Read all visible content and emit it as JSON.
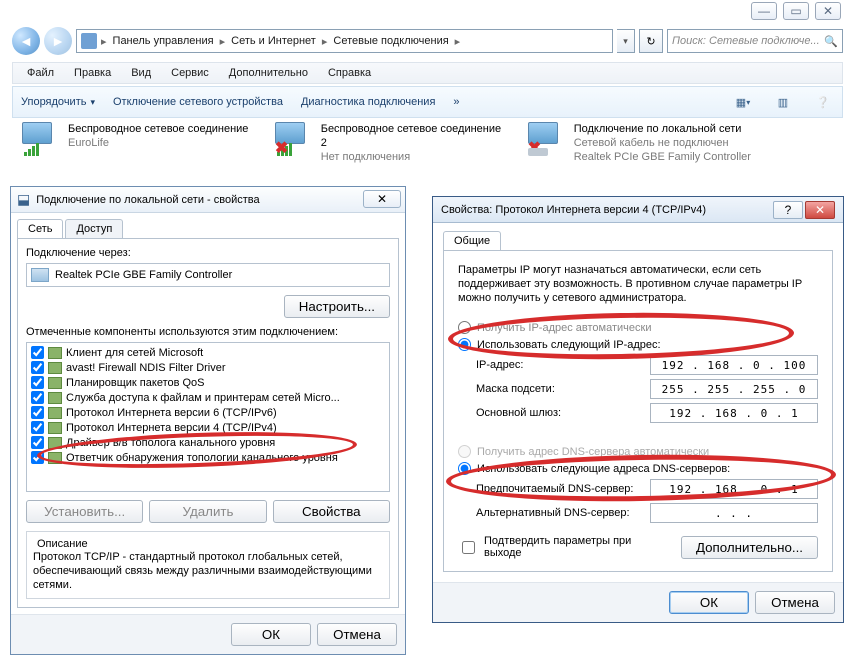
{
  "window": {
    "breadcrumb": [
      "Панель управления",
      "Сеть и Интернет",
      "Сетевые подключения"
    ],
    "search_placeholder": "Поиск: Сетевые подключе..."
  },
  "menu": {
    "file": "Файл",
    "edit": "Правка",
    "view": "Вид",
    "service": "Сервис",
    "extra": "Дополнительно",
    "help": "Справка"
  },
  "toolbar": {
    "organize": "Упорядочить",
    "disable": "Отключение сетевого устройства",
    "diagnose": "Диагностика подключения"
  },
  "tiles": [
    {
      "name": "Беспроводное сетевое соединение",
      "status": "EuroLife"
    },
    {
      "name": "Беспроводное сетевое соединение 2",
      "status": "Нет подключения"
    },
    {
      "name": "Подключение по локальной сети",
      "status": "Сетевой кабель не подключен",
      "device": "Realtek PCIe GBE Family Controller"
    }
  ],
  "props": {
    "title": "Подключение по локальной сети - свойства",
    "tabs": {
      "net": "Сеть",
      "access": "Доступ"
    },
    "conn_via": "Подключение через:",
    "adapter": "Realtek PCIe GBE Family Controller",
    "configure": "Настроить...",
    "components_label": "Отмеченные компоненты используются этим подключением:",
    "components": [
      "Клиент для сетей Microsoft",
      "avast! Firewall NDIS Filter Driver",
      "Планировщик пакетов QoS",
      "Служба доступа к файлам и принтерам сетей Micro...",
      "Протокол Интернета версии 6 (TCP/IPv6)",
      "Протокол Интернета версии 4 (TCP/IPv4)",
      "Драйвер в/в тополога канального уровня",
      "Ответчик обнаружения топологии канального уровня"
    ],
    "install": "Установить...",
    "remove": "Удалить",
    "properties": "Свойства",
    "desc_group": "Описание",
    "desc": "Протокол TCP/IP - стандартный протокол глобальных сетей, обеспечивающий связь между различными взаимодействующими сетями.",
    "ok": "ОК",
    "cancel": "Отмена"
  },
  "ipv4": {
    "title": "Свойства: Протокол Интернета версии 4 (TCP/IPv4)",
    "tab": "Общие",
    "desc": "Параметры IP могут назначаться автоматически, если сеть поддерживает эту возможность. В противном случае параметры IP можно получить у сетевого администратора.",
    "r_auto_ip": "Получить IP-адрес автоматически",
    "r_manual_ip": "Использовать следующий IP-адрес:",
    "ip_label": "IP-адрес:",
    "ip": "192 . 168 .  0  . 100",
    "mask_label": "Маска подсети:",
    "mask": "255 . 255 . 255 .  0",
    "gw_label": "Основной шлюз:",
    "gw": "192 . 168 .  0  .  1",
    "r_auto_dns": "Получить адрес DNS-сервера автоматически",
    "r_manual_dns": "Использовать следующие адреса DNS-серверов:",
    "dns1_label": "Предпочитаемый DNS-сервер:",
    "dns1": "192 . 168 .  0  .  1",
    "dns2_label": "Альтернативный DNS-сервер:",
    "dns2": " .       .       . ",
    "validate": "Подтвердить параметры при выходе",
    "advanced": "Дополнительно...",
    "ok": "ОК",
    "cancel": "Отмена"
  }
}
